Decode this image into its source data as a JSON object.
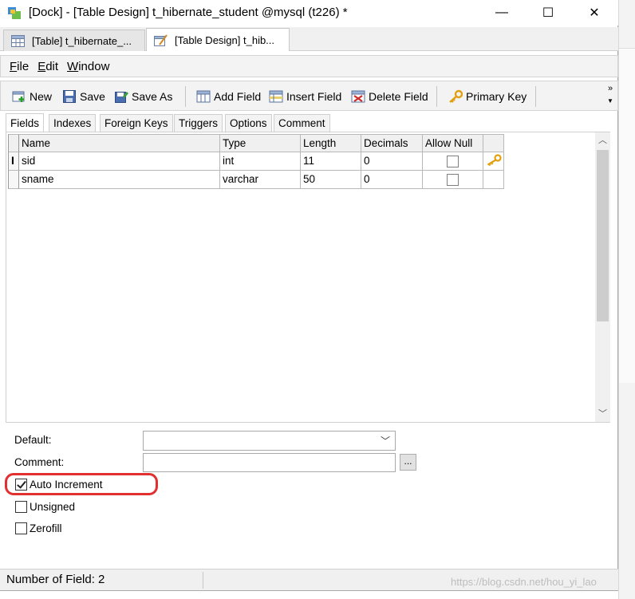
{
  "window": {
    "title": "[Dock] - [Table Design] t_hibernate_student @mysql (t226) *",
    "minimize": "—",
    "maximize": "☐",
    "close": "✕"
  },
  "doc_tabs": [
    {
      "label": "[Table] t_hibernate_...",
      "icon": "table-icon"
    },
    {
      "label": "[Table Design] t_hib...",
      "icon": "table-design-icon"
    }
  ],
  "menu": [
    {
      "accel": "F",
      "rest": "ile"
    },
    {
      "accel": "E",
      "rest": "dit"
    },
    {
      "accel": "W",
      "rest": "indow"
    }
  ],
  "toolbar": {
    "new": "New",
    "save": "Save",
    "save_as": "Save As",
    "add_field": "Add Field",
    "insert_field": "Insert Field",
    "delete_field": "Delete Field",
    "primary_key": "Primary Key",
    "overflow": "»"
  },
  "tabs": [
    "Fields",
    "Indexes",
    "Foreign Keys",
    "Triggers",
    "Options",
    "Comment"
  ],
  "grid": {
    "columns": [
      "Name",
      "Type",
      "Length",
      "Decimals",
      "Allow Null",
      ""
    ],
    "rows": [
      {
        "name": "sid",
        "type": "int",
        "length": "11",
        "decimals": "0",
        "allow_null": false,
        "primary_key": true
      },
      {
        "name": "sname",
        "type": "varchar",
        "length": "50",
        "decimals": "0",
        "allow_null": false,
        "primary_key": false
      }
    ]
  },
  "properties": {
    "default_label": "Default:",
    "default_value": "",
    "comment_label": "Comment:",
    "comment_value": "",
    "ellipsis": "...",
    "auto_increment_label": "Auto Increment",
    "auto_increment": true,
    "unsigned_label": "Unsigned",
    "unsigned": false,
    "zerofill_label": "Zerofill",
    "zerofill": false
  },
  "status": {
    "fields_count": "Number of Field: 2"
  },
  "watermark": "https://blog.csdn.net/hou_yi_lao",
  "colors": {
    "highlight": "#e23030",
    "key": "#e0a010"
  }
}
